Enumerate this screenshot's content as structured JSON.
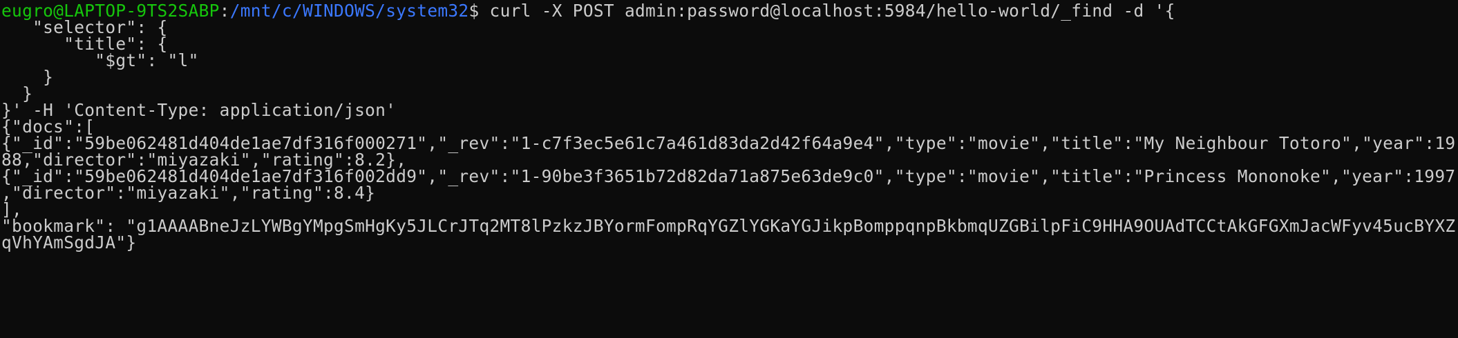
{
  "terminal": {
    "prompt": {
      "user_host": "eugro@LAPTOP-9TS2SABP",
      "separator": ":",
      "cwd": "/mnt/c/WINDOWS/system32",
      "symbol": "$"
    },
    "command": " curl -X POST admin:password@localhost:5984/hello-world/_find -d '{",
    "lines": [
      "   \"selector\": {",
      "      \"title\": {",
      "         \"$gt\": \"l\"",
      "    }",
      "  }",
      "}' -H 'Content-Type: application/json'",
      "{\"docs\":[",
      "{\"_id\":\"59be062481d404de1ae7df316f000271\",\"_rev\":\"1-c7f3ec5e61c7a461d83da2d42f64a9e4\",\"type\":\"movie\",\"title\":\"My Neighbour Totoro\",\"year\":19",
      "88,\"director\":\"miyazaki\",\"rating\":8.2},",
      "{\"_id\":\"59be062481d404de1ae7df316f002dd9\",\"_rev\":\"1-90be3f3651b72d82da71a875e63de9c0\",\"type\":\"movie\",\"title\":\"Princess Mononoke\",\"year\":1997",
      ",\"director\":\"miyazaki\",\"rating\":8.4}",
      "],",
      "\"bookmark\": \"g1AAAABneJzLYWBgYMpgSmHgKy5JLCrJTq2MT8lPzkzJBYormFompRqYGZlYGKaYGJikpBomppqnpBkbmqUZGBilpFiC9HHA9OUAdTCCtAkGFGXmJacWFyv45ucBYXZ",
      "qVhYAmSgdJA\"}"
    ]
  },
  "colors": {
    "background": "#0c0c0c",
    "text": "#cccccc",
    "user_host": "#16c60c",
    "path": "#3b78ff"
  }
}
